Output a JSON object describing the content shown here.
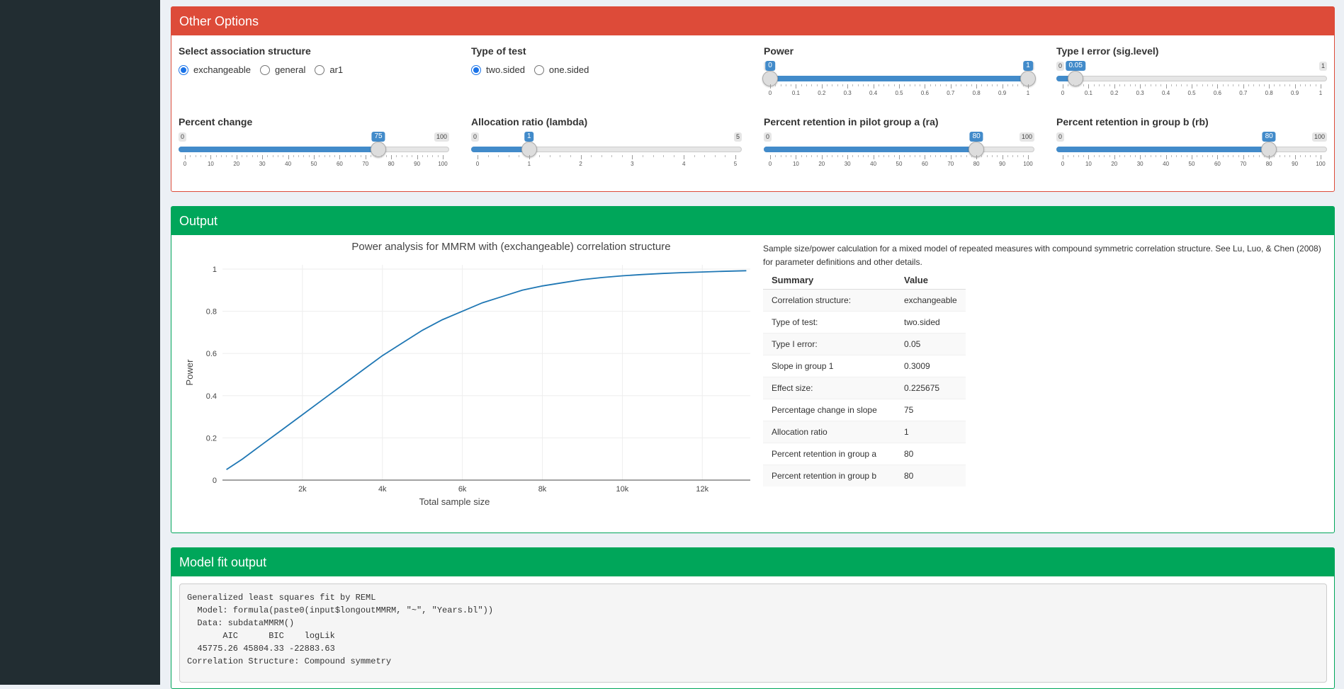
{
  "colors": {
    "sidebar": "#222d32",
    "danger": "#dd4b39",
    "success": "#00a65a",
    "slider": "#428bca",
    "line": "#1f77b4"
  },
  "other_options": {
    "title": "Other Options",
    "assoc": {
      "label": "Select association structure",
      "options": [
        "exchangeable",
        "general",
        "ar1"
      ],
      "selected": "exchangeable"
    },
    "test": {
      "label": "Type of test",
      "options": [
        "two.sided",
        "one.sided"
      ],
      "selected": "two.sided"
    },
    "power": {
      "label": "Power",
      "min": "0",
      "max": "1",
      "value_low": "0",
      "value_high": "1",
      "ticks": [
        "0",
        "0.1",
        "0.2",
        "0.3",
        "0.4",
        "0.5",
        "0.6",
        "0.7",
        "0.8",
        "0.9",
        "1"
      ]
    },
    "alpha": {
      "label": "Type I error (sig.level)",
      "min": "0",
      "max": "1",
      "value": "0.05",
      "ticks": [
        "0",
        "0.1",
        "0.2",
        "0.3",
        "0.4",
        "0.5",
        "0.6",
        "0.7",
        "0.8",
        "0.9",
        "1"
      ]
    },
    "pct_change": {
      "label": "Percent change",
      "min": "0",
      "max": "100",
      "value": "75",
      "ticks": [
        "0",
        "10",
        "20",
        "30",
        "40",
        "50",
        "60",
        "70",
        "80",
        "90",
        "100"
      ]
    },
    "lambda": {
      "label": "Allocation ratio (lambda)",
      "min": "0",
      "max": "5",
      "value": "1",
      "ticks": [
        "0",
        "1",
        "2",
        "3",
        "4",
        "5"
      ]
    },
    "ra": {
      "label": "Percent retention in pilot group a (ra)",
      "min": "0",
      "max": "100",
      "value": "80",
      "ticks": [
        "0",
        "10",
        "20",
        "30",
        "40",
        "50",
        "60",
        "70",
        "80",
        "90",
        "100"
      ]
    },
    "rb": {
      "label": "Percent retention in group b (rb)",
      "min": "0",
      "max": "100",
      "value": "80",
      "ticks": [
        "0",
        "10",
        "20",
        "30",
        "40",
        "50",
        "60",
        "70",
        "80",
        "90",
        "100"
      ]
    }
  },
  "output": {
    "title": "Output",
    "description": "Sample size/power calculation for a mixed model of repeated measures with compound symmetric correlation structure. See Lu, Luo, & Chen (2008) for parameter definitions and other details.",
    "table_headers": [
      "Summary",
      "Value"
    ],
    "table_rows": [
      [
        "Correlation structure:",
        "exchangeable"
      ],
      [
        "Type of test:",
        "two.sided"
      ],
      [
        "Type I error:",
        "0.05"
      ],
      [
        "Slope in group 1",
        "0.3009"
      ],
      [
        "Effect size:",
        "0.225675"
      ],
      [
        "Percentage change in slope",
        "75"
      ],
      [
        "Allocation ratio",
        "1"
      ],
      [
        "Percent retention in group a",
        "80"
      ],
      [
        "Percent retention in group b",
        "80"
      ]
    ]
  },
  "chart_data": {
    "type": "line",
    "title": "Power analysis for MMRM with (exchangeable) correlation structure",
    "xlabel": "Total sample size",
    "ylabel": "Power",
    "xlim": [
      0,
      13200
    ],
    "ylim": [
      0,
      1.02
    ],
    "x_ticks": [
      2000,
      4000,
      6000,
      8000,
      10000,
      12000
    ],
    "x_tick_labels": [
      "2k",
      "4k",
      "6k",
      "8k",
      "10k",
      "12k"
    ],
    "y_ticks": [
      0,
      0.2,
      0.4,
      0.6,
      0.8,
      1
    ],
    "y_tick_labels": [
      "0",
      "0.2",
      "0.4",
      "0.6",
      "0.8",
      "1"
    ],
    "grid": true,
    "series": [
      {
        "x": [
          100,
          500,
          1000,
          1500,
          2000,
          2500,
          3000,
          3500,
          4000,
          4500,
          5000,
          5500,
          6000,
          6500,
          7000,
          7500,
          8000,
          8500,
          9000,
          9500,
          10000,
          10500,
          11000,
          11500,
          12000,
          12500,
          13100
        ],
        "y": [
          0.05,
          0.1,
          0.17,
          0.24,
          0.31,
          0.38,
          0.45,
          0.52,
          0.59,
          0.65,
          0.71,
          0.76,
          0.8,
          0.84,
          0.87,
          0.9,
          0.92,
          0.935,
          0.95,
          0.96,
          0.968,
          0.974,
          0.979,
          0.983,
          0.986,
          0.989,
          0.992
        ]
      }
    ]
  },
  "model_fit": {
    "title": "Model fit output",
    "lines": [
      "Generalized least squares fit by REML",
      "  Model: formula(paste0(input$longoutMMRM, \"~\", \"Years.bl\"))",
      "  Data: subdataMMRM()",
      "       AIC      BIC    logLik",
      "  45775.26 45804.33 -22883.63",
      "",
      "Correlation Structure: Compound symmetry"
    ]
  }
}
